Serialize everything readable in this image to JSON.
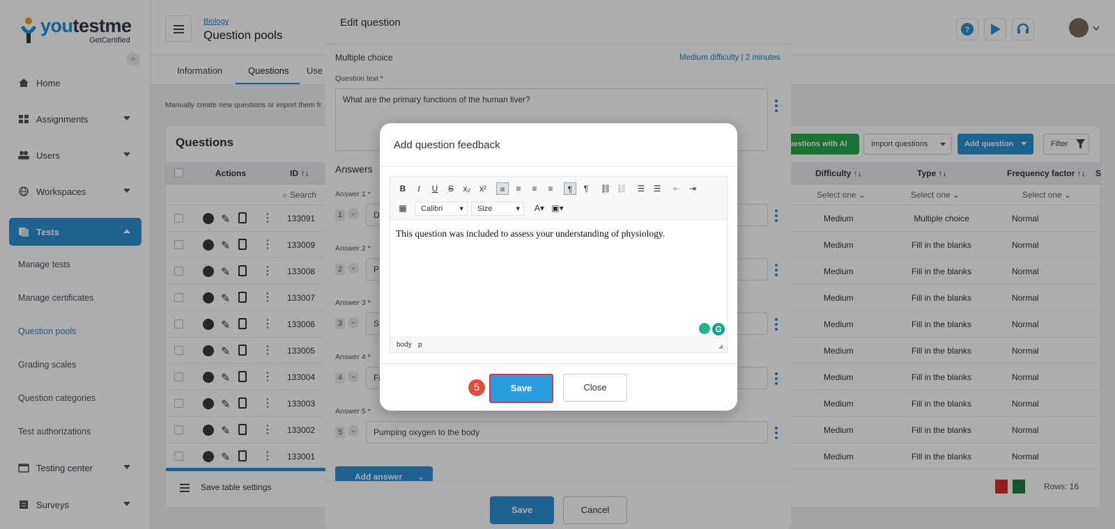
{
  "brand": {
    "name_a": "you",
    "name_b": "testme",
    "sub": "GetCertified"
  },
  "sidebar": {
    "items": [
      {
        "label": "Home"
      },
      {
        "label": "Assignments"
      },
      {
        "label": "Users"
      },
      {
        "label": "Workspaces"
      },
      {
        "label": "Tests"
      },
      {
        "label": "Testing center"
      },
      {
        "label": "Surveys"
      }
    ],
    "sub_items": [
      "Manage tests",
      "Manage certificates",
      "Question pools",
      "Grading scales",
      "Question categories",
      "Test authorizations"
    ]
  },
  "header": {
    "breadcrumb": "Biology",
    "title": "Question pools"
  },
  "tabs": [
    "Information",
    "Questions",
    "Use"
  ],
  "info_text": "Manually create new questions or import them fr",
  "card": {
    "title": "Questions",
    "btn_ai": "questions with AI",
    "btn_import": "Import questions",
    "btn_add": "Add question",
    "btn_filter": "Filter",
    "headers": {
      "actions": "Actions",
      "id": "ID",
      "difficulty": "Difficulty",
      "type": "Type",
      "frequency": "Frequency factor",
      "extra": "S"
    },
    "filter": {
      "search": "Search",
      "select1": "Select one",
      "select2": "Select one",
      "select3": "Select one"
    },
    "rows": [
      {
        "id": "133091",
        "difficulty": "Medium",
        "type": "Multiple choice",
        "frequency": "Normal"
      },
      {
        "id": "133009",
        "difficulty": "Medium",
        "type": "Fill in the blanks",
        "frequency": "Normal"
      },
      {
        "id": "133008",
        "difficulty": "Medium",
        "type": "Fill in the blanks",
        "frequency": "Normal"
      },
      {
        "id": "133007",
        "difficulty": "Medium",
        "type": "Fill in the blanks",
        "frequency": "Normal"
      },
      {
        "id": "133006",
        "difficulty": "Medium",
        "type": "Fill in the blanks",
        "frequency": "Normal"
      },
      {
        "id": "133005",
        "difficulty": "Medium",
        "type": "Fill in the blanks",
        "frequency": "Normal"
      },
      {
        "id": "133004",
        "difficulty": "Medium",
        "type": "Fill in the blanks",
        "frequency": "Normal"
      },
      {
        "id": "133003",
        "difficulty": "Medium",
        "type": "Fill in the blanks",
        "frequency": "Normal"
      },
      {
        "id": "133002",
        "difficulty": "Medium",
        "type": "Fill in the blanks",
        "frequency": "Normal"
      },
      {
        "id": "133001",
        "difficulty": "Medium",
        "type": "Fill in the blanks",
        "frequency": "Normal"
      }
    ],
    "footer_settings": "Save table settings",
    "rows_count": "Rows: 16"
  },
  "edit_modal": {
    "title": "Edit question",
    "question_type": "Multiple choice",
    "difficulty": "Medium difficulty",
    "time": "2 minutes",
    "question_label": "Question text *",
    "question_text": "What are the primary functions of the human liver?",
    "answers_heading": "Answers",
    "answers": [
      {
        "label": "Answer 1 *",
        "num": "1",
        "text": "D"
      },
      {
        "label": "Answer 2 *",
        "num": "2",
        "text": "P"
      },
      {
        "label": "Answer 3 *",
        "num": "3",
        "text": "St"
      },
      {
        "label": "Answer 4 *",
        "num": "4",
        "text": "Fi"
      },
      {
        "label": "Answer 5 *",
        "num": "5",
        "text": "Pumping oxygen to the body"
      }
    ],
    "add_answer": "Add answer",
    "save": "Save",
    "cancel": "Cancel"
  },
  "feedback_modal": {
    "title": "Add question feedback",
    "font": "Calibri",
    "size": "Size",
    "content": "This question was included to assess your understanding of physiology.",
    "status_body": "body",
    "status_p": "p",
    "step": "5",
    "save": "Save",
    "close": "Close"
  },
  "colors": {
    "accent": "#2b8fd1",
    "green": "#2aa44f",
    "highlight": "#e0333f"
  }
}
